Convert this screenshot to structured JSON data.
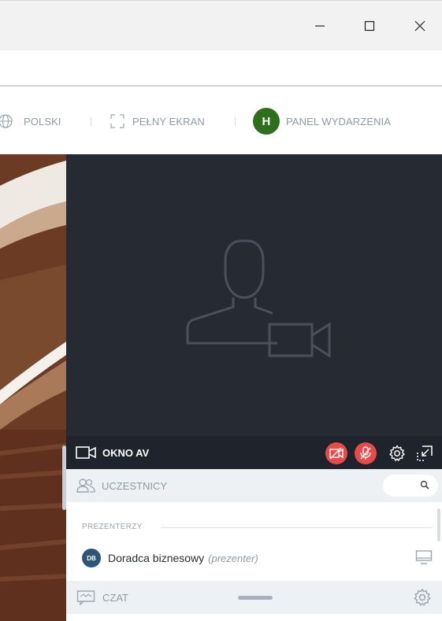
{
  "window": {
    "minimize_glyph": "—",
    "close_glyph": "✕"
  },
  "nav": {
    "language_label": "POLSKI",
    "fullscreen_label": "PEŁNY EKRAN",
    "panel_avatar_letter": "H",
    "panel_label": "PANEL WYDARZENIA"
  },
  "av": {
    "label": "OKNO AV"
  },
  "participants": {
    "header_label": "UCZESTNICY",
    "section_title": "PREZENTERZY",
    "items": [
      {
        "initials": "DB",
        "name": "Doradca biznesowy",
        "role": "(prezenter)"
      }
    ]
  },
  "chat": {
    "label": "CZAT"
  },
  "colors": {
    "accent_green": "#2e6f1b",
    "alert_red": "#e84a4a",
    "video_bg": "#252a33",
    "avatar_blue": "#2c5577"
  },
  "icons": [
    "globe-icon",
    "fullscreen-icon",
    "video-camera-icon",
    "camera-off-icon",
    "mic-off-icon",
    "gear-icon",
    "minimize-window-icon",
    "users-icon",
    "search-icon",
    "screen-share-icon",
    "chat-icon"
  ]
}
